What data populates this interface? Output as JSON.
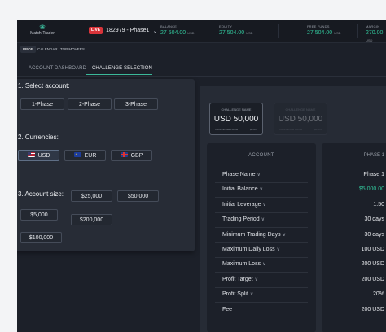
{
  "header": {
    "logo_text": "Match-Trader",
    "live_badge": "LIVE",
    "account": "182979 - Phase1",
    "stats": [
      {
        "label": "BALANCE",
        "value": "27 504.00",
        "unit": "USD"
      },
      {
        "label": "EQUITY",
        "value": "27 504.00",
        "unit": "USD"
      },
      {
        "label": "FREE FUNDS",
        "value": "27 504.00",
        "unit": "USD"
      },
      {
        "label": "MARGIN",
        "value": "270.00",
        "unit": "USD"
      }
    ]
  },
  "topnav": {
    "items": [
      "PROP",
      "CALENDAR",
      "TOP MOVERS"
    ]
  },
  "tabs": {
    "items": [
      "ACCOUNT DASHBOARD",
      "CHALLENGE SELECTION"
    ]
  },
  "config": {
    "account_title": "1. Select account:",
    "account_options": [
      "1-Phase",
      "2-Phase",
      "3-Phase"
    ],
    "currency_title": "2. Currencies:",
    "currency_options": [
      "USD",
      "EUR",
      "GBP"
    ],
    "size_title": "3. Account size:",
    "size_options": [
      "$25,000",
      "$50,000",
      "$5,000",
      "$200,000",
      "$100,000"
    ]
  },
  "challenges": [
    {
      "label": "CHALLENGE NAME",
      "value": "USD 50,000",
      "small_left": "CHALLENGE PRICE",
      "small_right": "$250.0"
    },
    {
      "label": "CHALLENGE NAME",
      "value": "USD 50,000",
      "small_left": "CHALLENGE PRICE",
      "small_right": "$250.0"
    }
  ],
  "table": {
    "account_header": "ACCOUNT",
    "phase_header": "PHASE 1",
    "rows": [
      {
        "label": "Phase Name",
        "icon": "chevron-down",
        "value": "Phase 1"
      },
      {
        "label": "Initial Balance",
        "icon": "chevron-down",
        "value": "$5,000.00"
      },
      {
        "label": "Initial Leverage",
        "icon": "chevron-down",
        "value": "1:50"
      },
      {
        "label": "Trading Period",
        "icon": "chevron-down",
        "value": "30 days"
      },
      {
        "label": "Minimum Trading Days",
        "icon": "chevron-down",
        "value": "30 days"
      },
      {
        "label": "Maximum Daily Loss",
        "icon": "chevron-down",
        "value": "100 USD"
      },
      {
        "label": "Maximum Loss",
        "icon": "chevron-down",
        "value": "200 USD"
      },
      {
        "label": "Profit Target",
        "icon": "chevron-down",
        "value": "200 USD"
      },
      {
        "label": "Profit Split",
        "icon": "chevron-down",
        "value": "20%"
      },
      {
        "label": "Fee",
        "icon": "",
        "value": "200 USD"
      }
    ]
  },
  "colors": {
    "accent": "#3bb89a",
    "positive": "#32c59b",
    "live": "#d9343a",
    "background": "#1c2029"
  }
}
